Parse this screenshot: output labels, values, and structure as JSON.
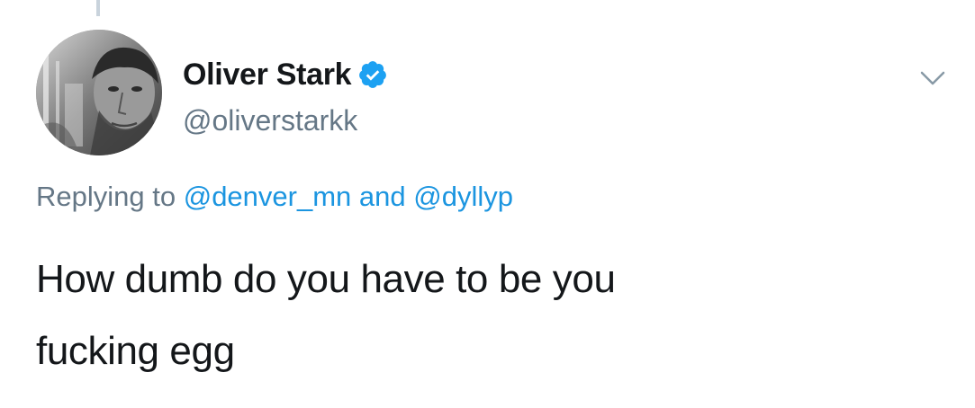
{
  "tweet": {
    "author": {
      "display_name": "Oliver Stark",
      "handle": "@oliverstarkk",
      "verified": true
    },
    "reply": {
      "prefix": "Replying to",
      "mention_1": "@denver_mn",
      "conjunction": "and",
      "mention_2": "@dyllyp"
    },
    "text_lines": [
      "How dumb do you have to be you",
      "fucking egg"
    ]
  },
  "icons": {
    "verified": "verified-badge-icon",
    "menu": "chevron-down-icon"
  },
  "colors": {
    "accent": "#1da1f2",
    "mention": "#1b95e0",
    "secondary_text": "#657786",
    "primary_text": "#14171a"
  }
}
